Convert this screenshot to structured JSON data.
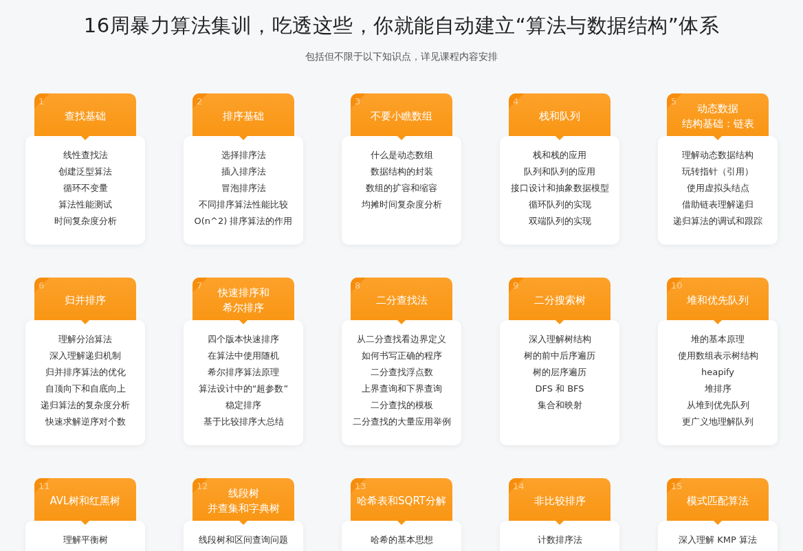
{
  "title": "16周暴力算法集训，吃透这些，你就能自动建立“算法与数据结构”体系",
  "subtitle": "包括但不限于以下知识点，详见课程内容安排",
  "rows": [
    [
      {
        "number": "1",
        "title": "查找基础",
        "items": [
          "线性查找法",
          "创建泛型算法",
          "循环不变量",
          "算法性能测试",
          "时间复杂度分析"
        ]
      },
      {
        "number": "2",
        "title": "排序基础",
        "items": [
          "选择排序法",
          "插入排序法",
          "冒泡排序法",
          "不同排序算法性能比较",
          "O(n^2) 排序算法的作用"
        ]
      },
      {
        "number": "3",
        "title": "不要小瞧数组",
        "items": [
          "什么是动态数组",
          "数据结构的封装",
          "数组的扩容和缩容",
          "均摊时间复杂度分析"
        ]
      },
      {
        "number": "4",
        "title": "栈和队列",
        "items": [
          "栈和栈的应用",
          "队列和队列的应用",
          "接口设计和抽象数据模型",
          "循环队列的实现",
          "双端队列的实现"
        ]
      },
      {
        "number": "5",
        "title": [
          "动态数据",
          "结构基础：链表"
        ],
        "items": [
          "理解动态数据结构",
          "玩转指针（引用）",
          "使用虚拟头结点",
          "借助链表理解递归",
          "递归算法的调试和跟踪"
        ]
      }
    ],
    [
      {
        "number": "6",
        "title": "归并排序",
        "items": [
          "理解分治算法",
          "深入理解递归机制",
          "归并排序算法的优化",
          "自顶向下和自底向上",
          "递归算法的复杂度分析",
          "快速求解逆序对个数"
        ]
      },
      {
        "number": "7",
        "title": [
          "快速排序和",
          "希尔排序"
        ],
        "items": [
          "四个版本快速排序",
          "在算法中使用随机",
          "希尔排序算法原理",
          "算法设计中的“超参数”",
          "稳定排序",
          "基于比较排序大总结"
        ]
      },
      {
        "number": "8",
        "title": "二分查找法",
        "items": [
          "从二分查找看边界定义",
          "如何书写正确的程序",
          "二分查找浮点数",
          "上界查询和下界查询",
          "二分查找的模板",
          "二分查找的大量应用举例"
        ]
      },
      {
        "number": "9",
        "title": "二分搜索树",
        "items": [
          "深入理解树结构",
          "树的前中后序遍历",
          "树的层序遍历",
          "DFS 和 BFS",
          "集合和映射"
        ]
      },
      {
        "number": "10",
        "title": "堆和优先队列",
        "items": [
          "堆的基本原理",
          "使用数组表示树结构",
          "heapify",
          "堆排序",
          "从堆到优先队列",
          "更广义地理解队列"
        ]
      }
    ],
    [
      {
        "number": "11",
        "title": "AVL树和红黑树",
        "items": [
          "理解平衡树"
        ]
      },
      {
        "number": "12",
        "title": [
          "线段树",
          "并查集和字典树"
        ],
        "items": [
          "线段树和区间查询问题"
        ]
      },
      {
        "number": "13",
        "title": "哈希表和SQRT分解",
        "items": [
          "哈希的基本思想"
        ]
      },
      {
        "number": "14",
        "title": "非比较排序",
        "items": [
          "计数排序法"
        ]
      },
      {
        "number": "15",
        "title": "模式匹配算法",
        "items": [
          "深入理解 KMP 算法"
        ]
      }
    ]
  ]
}
